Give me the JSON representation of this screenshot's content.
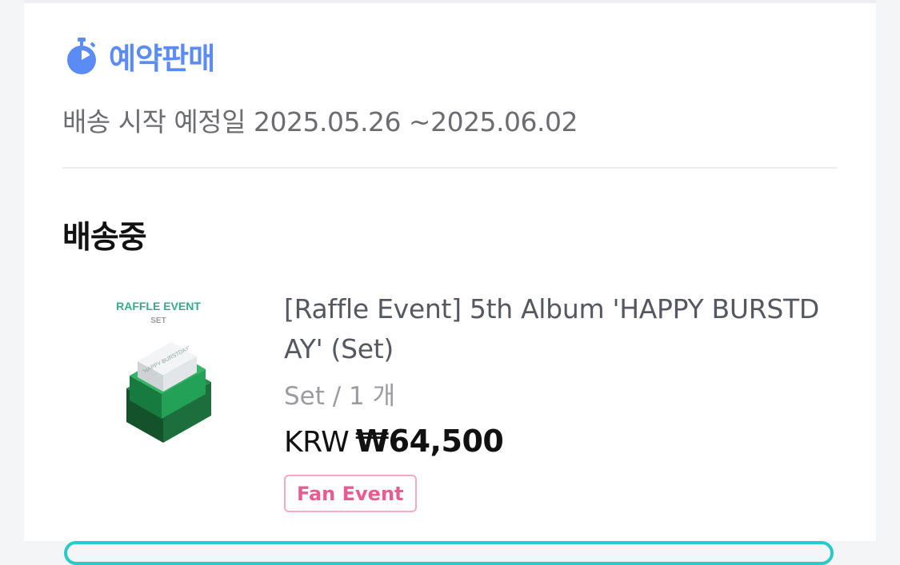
{
  "presale": {
    "icon": "stopwatch-icon",
    "label": "예약판매",
    "ship_date": "배송 시작 예정일 2025.05.26 ~2025.06.02",
    "color": "#5b8cf5"
  },
  "order": {
    "status": "배송중",
    "product": {
      "image_caption_line1": "RAFFLE EVENT",
      "image_caption_line2": "SET",
      "title": "[Raffle Event] 5th Album 'HAPPY BURSTDAY' (Set)",
      "option": "Set / 1 개",
      "currency": "KRW",
      "price": "₩64,500",
      "tag": "Fan Event",
      "tag_color": "#ec5a91"
    }
  }
}
